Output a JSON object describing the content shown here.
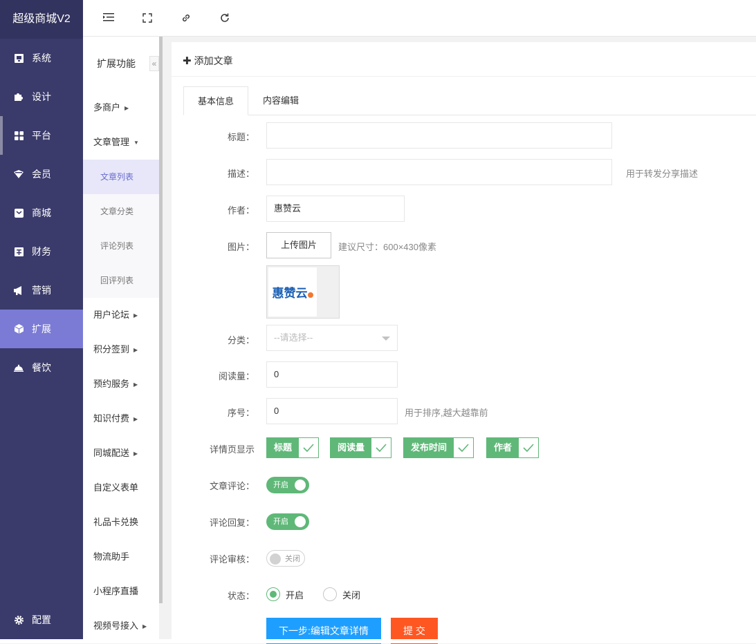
{
  "brand": "超级商城V2",
  "nav": [
    {
      "label": "系统",
      "icon": "system-icon"
    },
    {
      "label": "设计",
      "icon": "puzzle-icon"
    },
    {
      "label": "平台",
      "icon": "grid-icon"
    },
    {
      "label": "会员",
      "icon": "member-icon"
    },
    {
      "label": "商城",
      "icon": "mall-icon"
    },
    {
      "label": "财务",
      "icon": "finance-icon"
    },
    {
      "label": "营销",
      "icon": "megaphone-icon"
    },
    {
      "label": "扩展",
      "icon": "cube-icon"
    },
    {
      "label": "餐饮",
      "icon": "dining-icon"
    }
  ],
  "config_label": "配置",
  "subnav": {
    "title": "扩展功能",
    "collapse": "«",
    "items": [
      "多商户",
      "文章管理",
      "文章列表",
      "文章分类",
      "评论列表",
      "回评列表",
      "用户论坛",
      "积分签到",
      "预约服务",
      "知识付费",
      "同城配送",
      "自定义表单",
      "礼品卡兑换",
      "物流助手",
      "小程序直播",
      "视频号接入"
    ]
  },
  "card_title": "添加文章",
  "tabs": [
    "基本信息",
    "内容编辑"
  ],
  "form": {
    "title_label": "标题：",
    "desc_label": "描述：",
    "desc_hint": "用于转发分享描述",
    "author_label": "作者：",
    "author_value": "惠赞云",
    "image_label": "图片：",
    "upload_button": "上传图片",
    "image_hint": "建议尺寸：600×430像素",
    "thumb_logo": "惠赞云",
    "category_label": "分类：",
    "category_placeholder": "--请选择--",
    "reads_label": "阅读量：",
    "reads_value": "0",
    "order_label": "序号：",
    "order_value": "0",
    "order_hint": "用于排序,越大越靠前",
    "detail_label": "详情页显示",
    "detail_options": [
      "标题",
      "阅读量",
      "发布时间",
      "作者"
    ],
    "comment_label": "文章评论：",
    "comment_state": "开启",
    "reply_label": "评论回复：",
    "reply_state": "开启",
    "audit_label": "评论审核：",
    "audit_state": "关闭",
    "status_label": "状态：",
    "status_on": "开启",
    "status_off": "关闭",
    "next_button": "下一步:编辑文章详情",
    "submit_button": "提 交"
  },
  "colors": {
    "sidebar": "#3a3a6b",
    "active_nav": "#7b7bd6",
    "green": "#5fb878",
    "blue": "#1e9fff",
    "orange": "#ff5722"
  }
}
